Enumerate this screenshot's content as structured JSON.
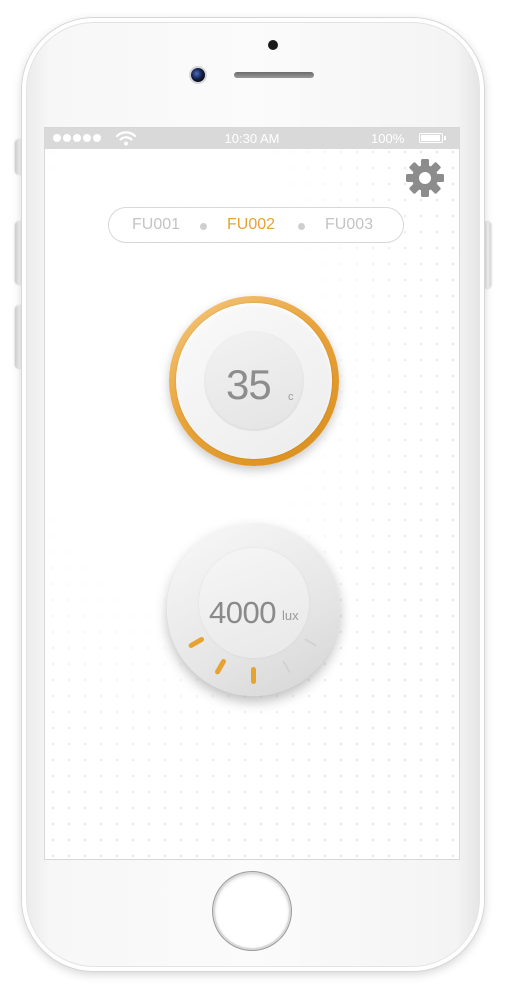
{
  "status_bar": {
    "time": "10:30 AM",
    "battery_text": "100%",
    "battery_level": 1.0,
    "signal_bars": 5
  },
  "icons": {
    "settings": "gear-icon",
    "wifi": "wifi-icon",
    "battery": "battery-icon"
  },
  "device_tabs": {
    "items": [
      {
        "label": "FU001",
        "active": false
      },
      {
        "label": "FU002",
        "active": true
      },
      {
        "label": "FU003",
        "active": false
      }
    ]
  },
  "temperature": {
    "value": "35",
    "unit": "c"
  },
  "illuminance": {
    "value": "4000",
    "unit": "lux",
    "level_ticks_total": 5,
    "level_ticks_active": 3
  },
  "colors": {
    "accent": "#e7a331",
    "inactive_text": "#c4c4c4",
    "value_text": "#8d8d8d",
    "tick_inactive": "#d2d2d2"
  }
}
